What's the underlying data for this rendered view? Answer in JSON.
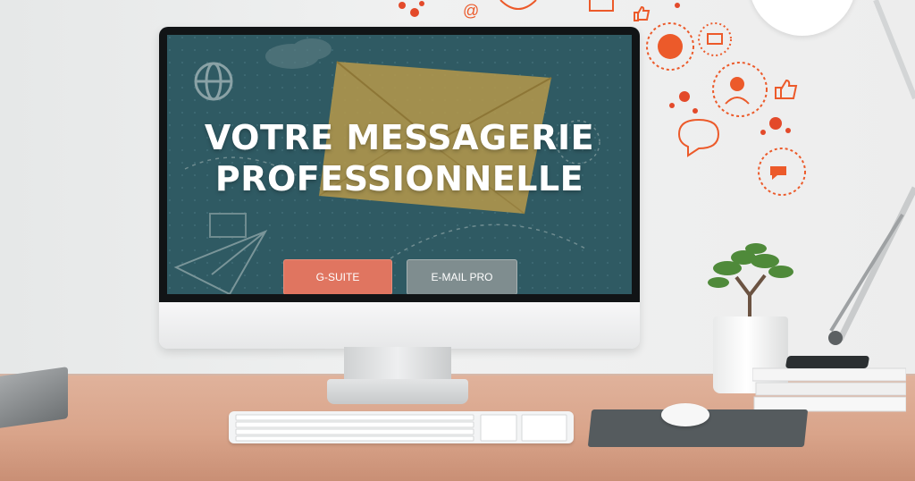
{
  "hero": {
    "headline_line1": "VOTRE MESSAGERIE",
    "headline_line2": "PROFESSIONNELLE"
  },
  "buttons": {
    "gsuite_label": "G-SUITE",
    "email_pro_label": "E-MAIL PRO"
  },
  "colors": {
    "screen_bg": "#2f5a63",
    "accent_orange": "#e07560",
    "button_grey": "#7f8d8f",
    "envelope": "#c9a84b",
    "icon_orange": "#ec5a2a"
  },
  "icons": [
    "globe-icon",
    "envelope-icon",
    "paper-plane-icon",
    "like-icon",
    "chat-icon",
    "user-search-icon",
    "at-icon"
  ]
}
